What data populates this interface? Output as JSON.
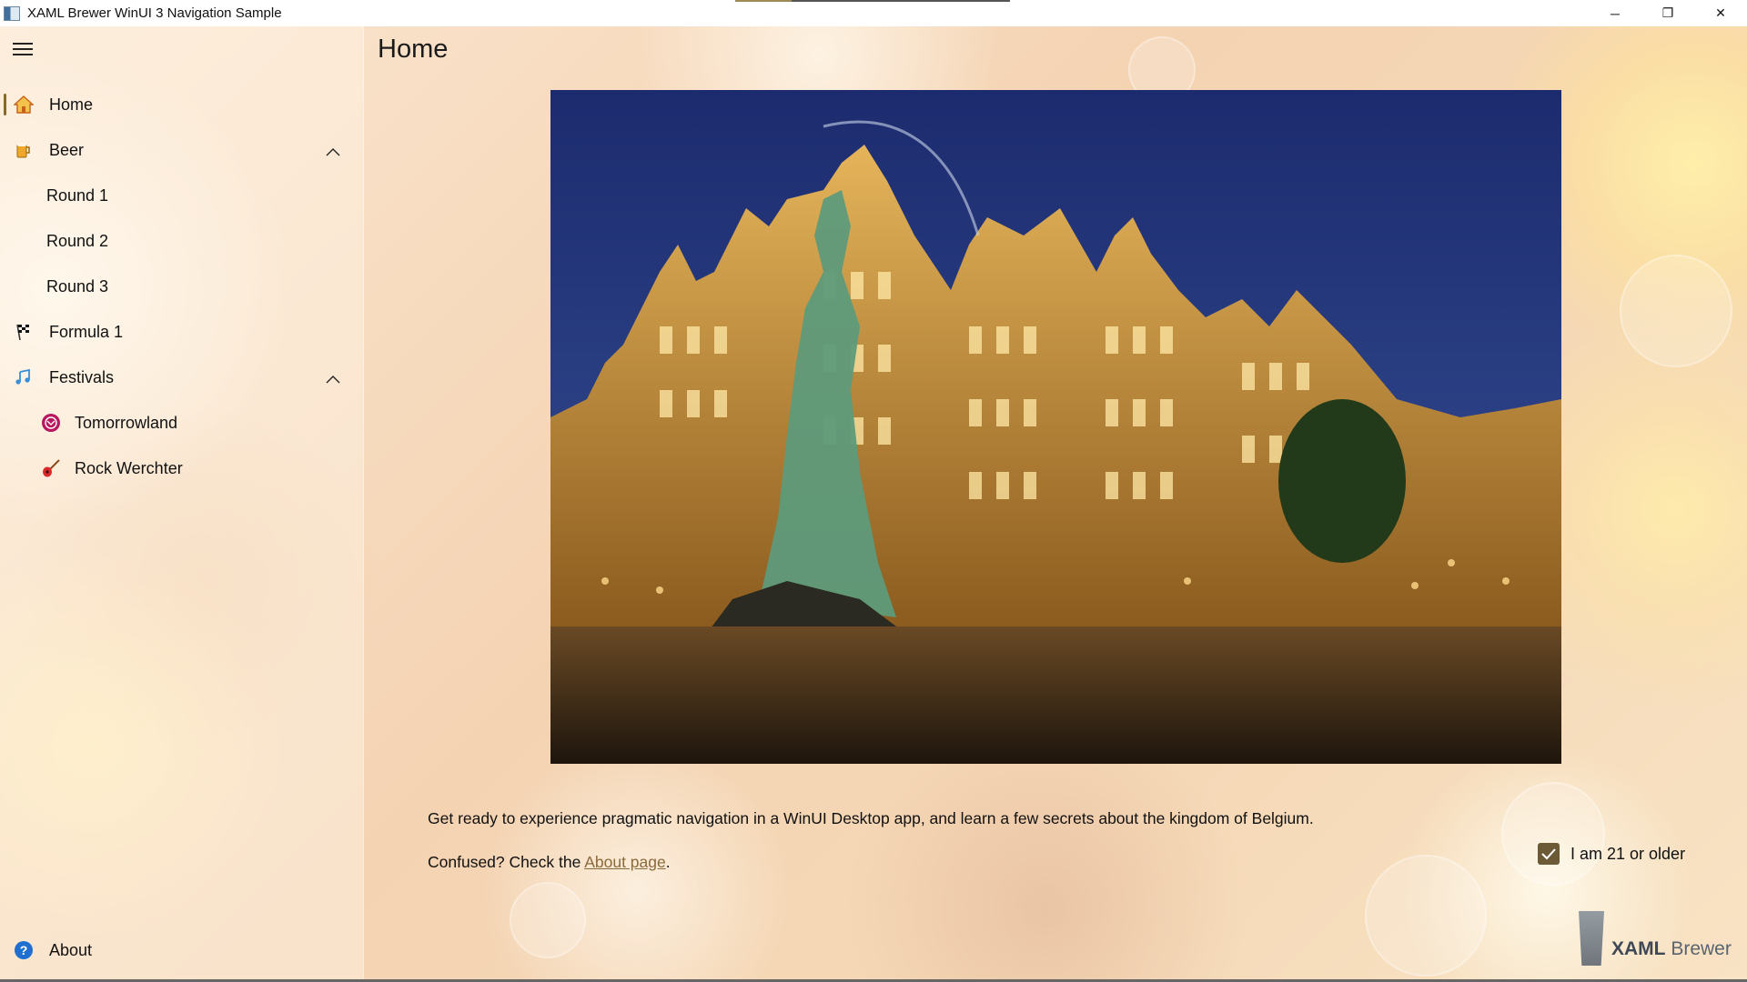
{
  "window": {
    "title": "XAML Brewer WinUI 3 Navigation Sample",
    "minimize_glyph": "─",
    "maximize_glyph": "❐",
    "close_glyph": "✕"
  },
  "nav": {
    "menu_icon": "hamburger-icon",
    "items": [
      {
        "label": "Home",
        "icon": "house-icon"
      },
      {
        "label": "Beer",
        "icon": "beer-mug-icon"
      },
      {
        "label": "Round 1"
      },
      {
        "label": "Round 2"
      },
      {
        "label": "Round 3"
      },
      {
        "label": "Formula 1",
        "icon": "checkered-flag-icon"
      },
      {
        "label": "Festivals",
        "icon": "music-notes-icon"
      },
      {
        "label": "Tomorrowland",
        "icon": "tomorrowland-icon"
      },
      {
        "label": "Rock Werchter",
        "icon": "guitar-icon"
      }
    ],
    "footer": {
      "label": "About",
      "icon": "help-icon"
    },
    "selected": "Home"
  },
  "content": {
    "page_title": "Home",
    "intro": "Get ready to experience pragmatic navigation in a WinUI Desktop app, and learn a few secrets about the kingdom of Belgium.",
    "confused_prefix": "Confused? Check the ",
    "about_link": "About page",
    "confused_suffix": ".",
    "age_checkbox_label": "I am 21 or older",
    "age_checked": true,
    "brand_bold": "XAML",
    "brand_rest": " Brewer"
  },
  "colors": {
    "accent": "#8a6a2a",
    "checkbox_fill": "#6b5a35",
    "link": "#8a6a3a"
  }
}
